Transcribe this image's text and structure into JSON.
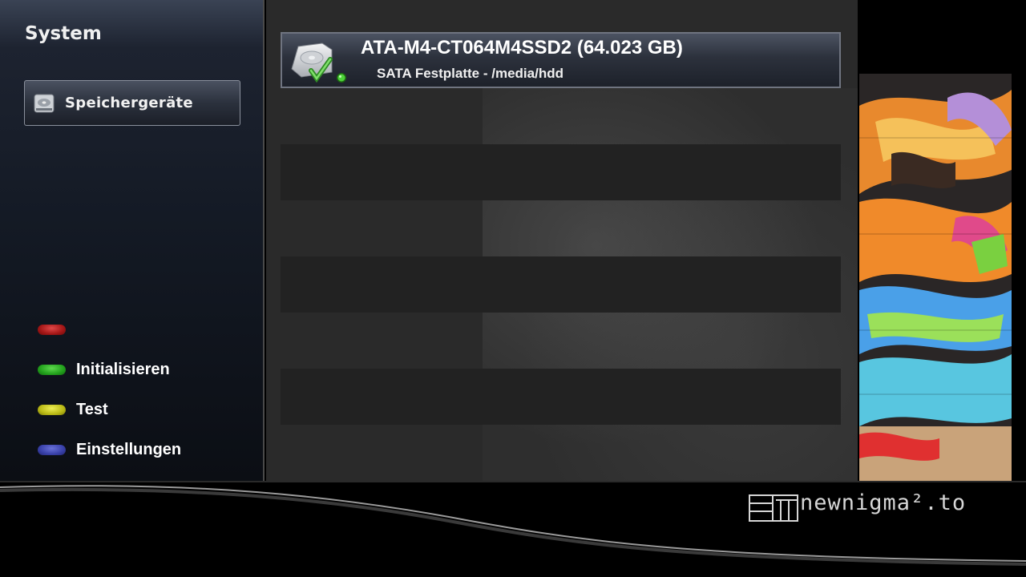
{
  "sidebar": {
    "title": "System",
    "selected_item": {
      "label": "Speichergeräte",
      "icon": "hdd-icon"
    }
  },
  "legend": {
    "red": {
      "color": "#a31616",
      "label": ""
    },
    "green": {
      "color": "#22a11c",
      "label": "Initialisieren"
    },
    "yellow": {
      "color": "#b9b915",
      "label": "Test"
    },
    "blue": {
      "color": "#3840a8",
      "label": "Einstellungen"
    }
  },
  "devices": [
    {
      "title": "ATA-M4-CT064M4SSD2 (64.023 GB)",
      "subtitle": "SATA Festplatte - /media/hdd",
      "icon": "hdd-check-icon",
      "status": "mounted"
    }
  ],
  "branding": {
    "logo_text": "newnigma²",
    "logo_suffix": ".to"
  }
}
